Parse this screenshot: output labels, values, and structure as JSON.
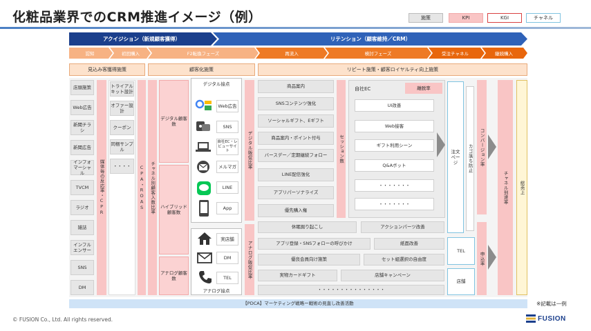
{
  "title": "化粧品業界でのCRM推進イメージ（例）",
  "legend": [
    "施策",
    "KPI",
    "KGI",
    "チャネル"
  ],
  "top_bands": {
    "acquisition": "アクイジション（新規顧客獲得）",
    "retention": "リテンション（顧客維持／CRM）"
  },
  "phases": [
    "認知",
    "初回購入",
    "F2転換フェーズ",
    "再流入",
    "検討フェーズ",
    "受注チャネル",
    "継続購入"
  ],
  "sections": {
    "prospect": "見込み客獲得施策",
    "customer": "顧客化施策",
    "repeat": "リピート施策・顧客ロイヤルティ向上施策"
  },
  "channels": [
    "店頭施策",
    "Web広告",
    "新聞チラシ",
    "新聞広告",
    "インフォマーシャル",
    "TVCM",
    "ラジオ",
    "雑誌",
    "インフルエンサー",
    "SNS",
    "DM"
  ],
  "kpi_cpr": "媒体毎の反応率・CPR",
  "trial": [
    "トライアルキット設計",
    "オファー設計",
    "クーポン",
    "同梱サンプル",
    "・・・・"
  ],
  "kpi_cpa": "CPA・ROAS",
  "kpi_channel_rate": "チャネル別顧客入数比率",
  "customer_types": [
    "デジタル顧客数",
    "ハイブリッド顧客数",
    "アナログ顧客数"
  ],
  "digital_title": "デジタル接点",
  "digital_items": [
    "Web広告",
    "SNS",
    "自社EC・レビューサイト",
    "メルマガ",
    "LINE",
    "App"
  ],
  "analog_title": "アナログ接点",
  "analog_items": [
    "実店舗",
    "DM",
    "TEL"
  ],
  "kpi_digital_rate": "デジタル販促比率",
  "kpi_analog_rate": "アナログ販促比率",
  "repeat_left": [
    "商品案内",
    "SNSコンテンツ強化",
    "ソーシャルギフト、Eギフト",
    "商品案内・ポイント付与",
    "バースデー／定期継続フォロー",
    "LINE配信強化",
    "アプリパーソナライズ",
    "優先購入権"
  ],
  "kpi_session": "セッション数",
  "ec_title": "自社EC",
  "ec_kpi": "離脱率",
  "ec_items": [
    "UI改善",
    "Web接客",
    "ギフト利用シーン",
    "Q&Aボット",
    "・・・・・・・",
    "・・・・・・・"
  ],
  "bottom_rows": [
    [
      "休眠掘り起こし",
      "アクションパーツ改善"
    ],
    [
      "アプリ登録・SNSフォローの呼びかけ",
      "紙面改善"
    ],
    [
      "優良会員向け施策",
      "セット組選択の自由度"
    ],
    [
      "実物カードギフト",
      "店舗キャンペーン"
    ],
    [
      "・・・・・・・・・・・・・・・"
    ]
  ],
  "order_channels": [
    "注文ページ",
    "TEL",
    "店舗"
  ],
  "kpi_cart": "カゴ落ち防止",
  "kpi_conversion": "コンバージョン率",
  "kpi_reorder": "申込率",
  "kpi_channel_reach": "チャネル到達率",
  "kgi": "総売上",
  "pdca": "【PDCA】マーケティング戦略ー戦術の見直し改善活動",
  "note": "※記載は一例",
  "copyright": "© FUSION Co., Ltd. All rights reserved.",
  "logo_text": "FUSION",
  "colors": {
    "navy": "#1b3f8c",
    "blue": "#2f62b8",
    "orange_light": "#f7b283",
    "orange": "#ee7a25",
    "orange_dark": "#e8660c",
    "pink": "#f9c5c5",
    "kgi_bg": "#fff6d6",
    "pdca_bg": "#cfe3f7"
  }
}
